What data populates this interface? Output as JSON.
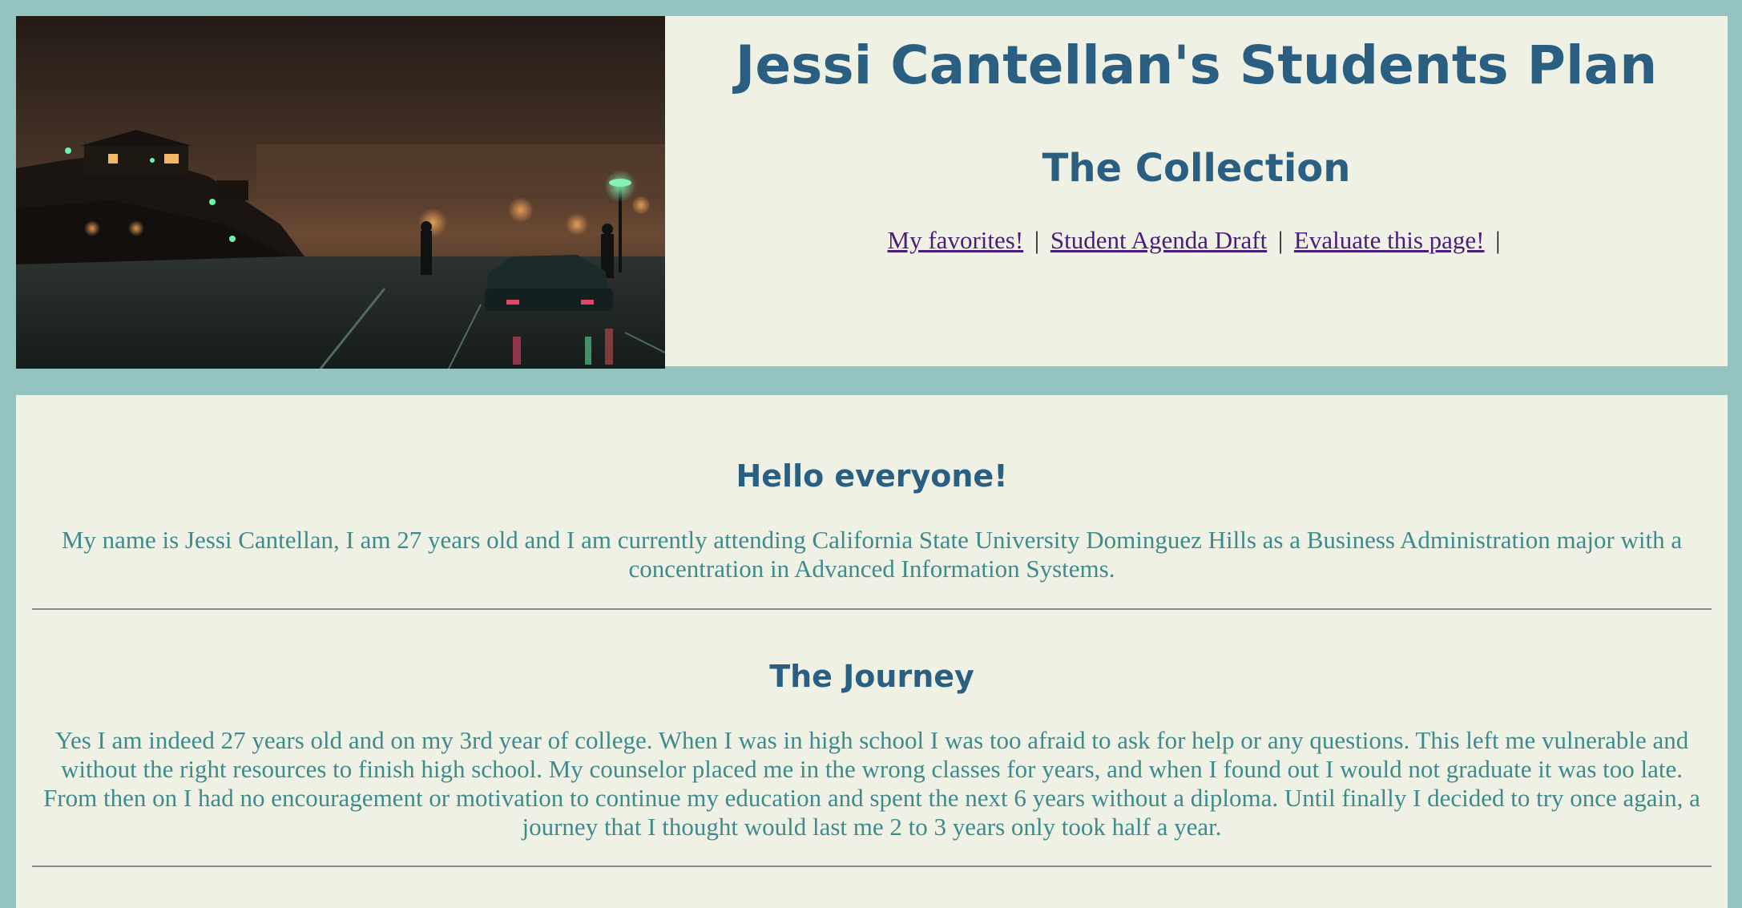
{
  "header": {
    "title": "Jessi Cantellan's Students Plan",
    "subtitle": "The Collection",
    "nav": [
      {
        "label": "My favorites!"
      },
      {
        "label": "Student Agenda Draft"
      },
      {
        "label": "Evaluate this page!"
      }
    ],
    "separator": "|"
  },
  "sections": [
    {
      "heading": "Hello everyone!",
      "body": "My name is Jessi Cantellan, I am 27 years old and I am currently attending California State University Dominguez Hills as a Business Administration major with a concentration in Advanced Information Systems."
    },
    {
      "heading": "The Journey",
      "body": "Yes I am indeed 27 years old and on my 3rd year of college. When I was in high school I was too afraid to ask for help or any questions. This left me vulnerable and without the right resources to finish high school. My counselor placed me in the wrong classes for years, and when I found out I would not graduate it was too late. From then on I had no encouragement or motivation to continue my education and spent the next 6 years without a diploma. Until finally I decided to try once again, a journey that I thought would last me 2 to 3 years only took half a year."
    }
  ],
  "colors": {
    "page_background": "#94c4bf",
    "panel_background": "#eff1e4",
    "heading": "#2b5f82",
    "body_text": "#3f8a8c",
    "link": "#4a1d7a"
  }
}
